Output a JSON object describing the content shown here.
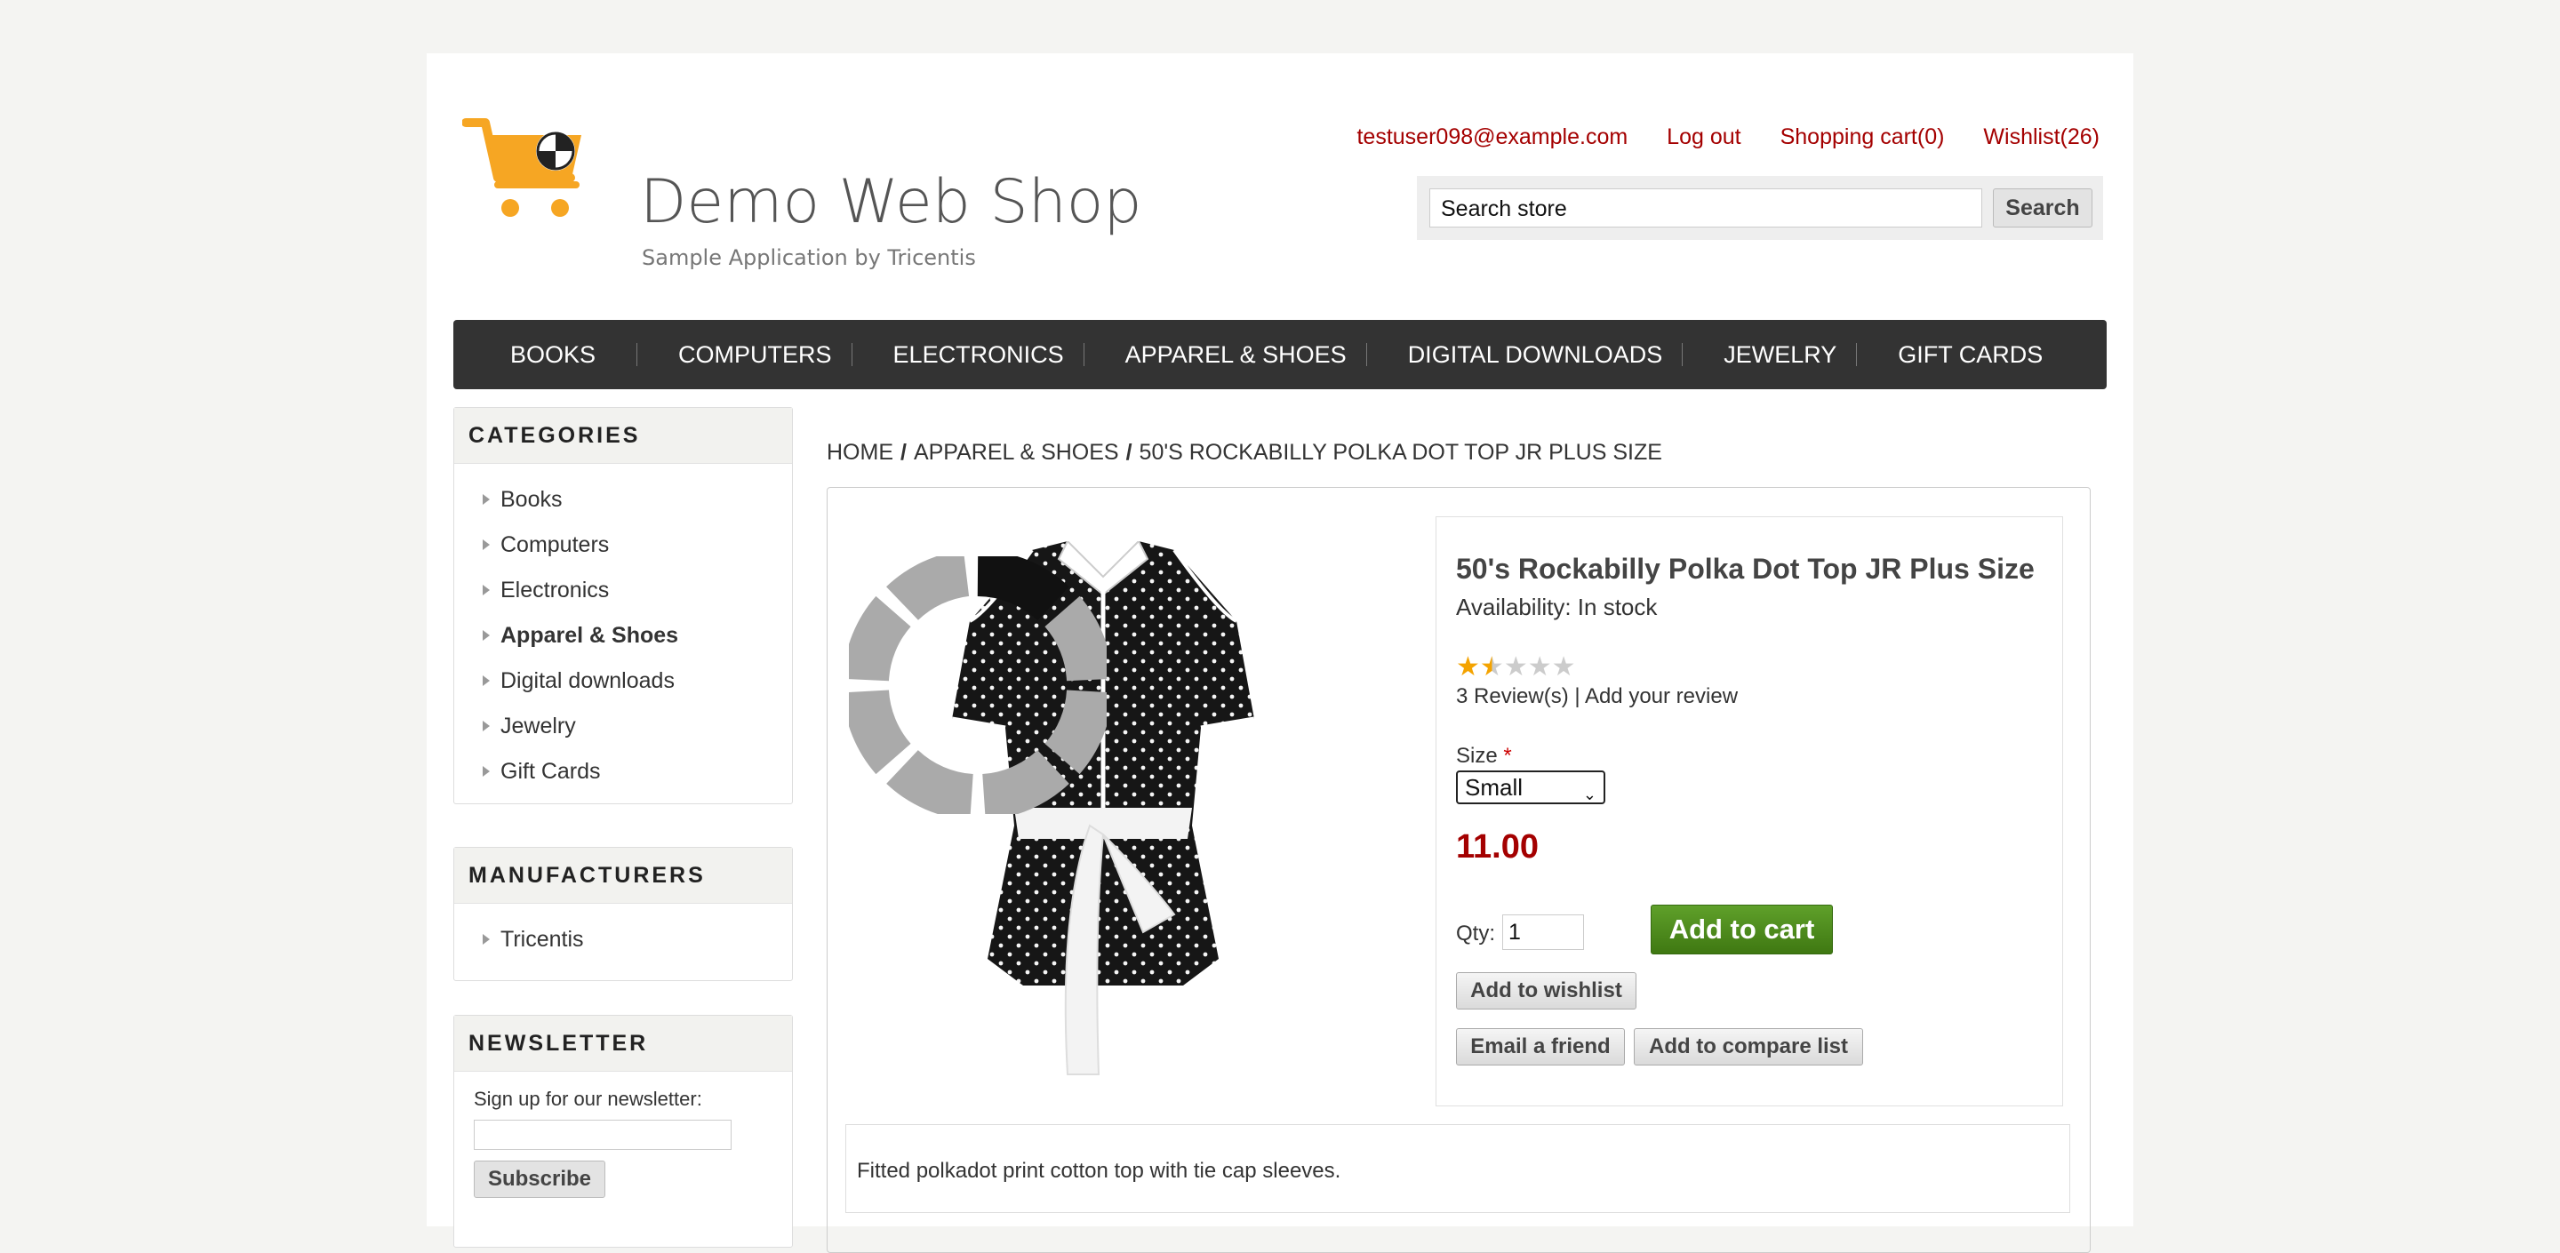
{
  "header": {
    "logo_title": "Demo Web Shop",
    "logo_subtitle": "Sample Application by Tricentis",
    "links": {
      "account": "testuser098@example.com",
      "logout": "Log out",
      "cart": "Shopping cart(0)",
      "wishlist": "Wishlist(26)"
    },
    "search": {
      "value": "Search store",
      "button": "Search"
    }
  },
  "top_menu": [
    "BOOKS",
    "COMPUTERS",
    "ELECTRONICS",
    "APPAREL & SHOES",
    "DIGITAL DOWNLOADS",
    "JEWELRY",
    "GIFT CARDS"
  ],
  "sidebar": {
    "categories_title": "CATEGORIES",
    "categories": [
      "Books",
      "Computers",
      "Electronics",
      "Apparel & Shoes",
      "Digital downloads",
      "Jewelry",
      "Gift Cards"
    ],
    "active_category": "Apparel & Shoes",
    "manufacturers_title": "MANUFACTURERS",
    "manufacturers": [
      "Tricentis"
    ],
    "newsletter_title": "NEWSLETTER",
    "newsletter_label": "Sign up for our newsletter:",
    "newsletter_button": "Subscribe"
  },
  "breadcrumb": [
    "HOME",
    "APPAREL & SHOES",
    "50'S ROCKABILLY POLKA DOT TOP JR PLUS SIZE"
  ],
  "product": {
    "name": "50's Rockabilly Polka Dot Top JR Plus Size",
    "availability": "Availability: In stock",
    "rating": 1.5,
    "rating_max": 5,
    "reviews_text": "3 Review(s)",
    "add_review": "Add your review",
    "size_label": "Size",
    "size_value": "Small",
    "price": "11.00",
    "qty_label": "Qty:",
    "qty_value": "1",
    "add_to_cart": "Add to cart",
    "add_to_wishlist": "Add to wishlist",
    "email_friend": "Email a friend",
    "add_compare": "Add to compare list",
    "description": "Fitted polkadot print cotton top with tie cap sleeves."
  },
  "colors": {
    "link_red": "#a40000",
    "menu_bg": "#333333",
    "cart_green": "#4b8a1b",
    "star": "#f4a300"
  }
}
